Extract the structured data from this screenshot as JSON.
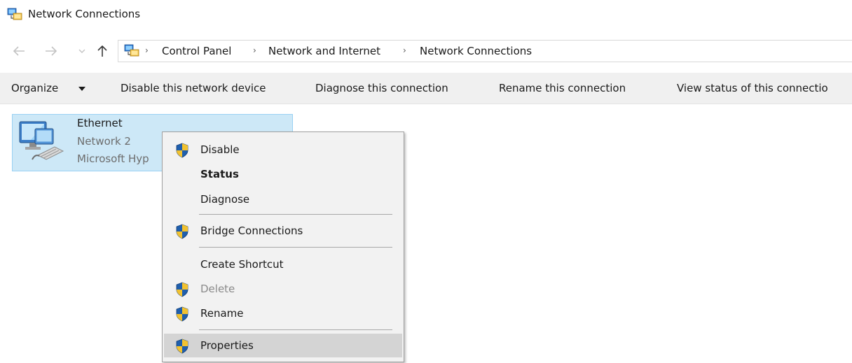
{
  "window": {
    "title": "Network Connections"
  },
  "address_bar": {
    "breadcrumbs": [
      "Control Panel",
      "Network and Internet",
      "Network Connections"
    ]
  },
  "command_bar": {
    "organize": "Organize",
    "disable": "Disable this network device",
    "diagnose": "Diagnose this connection",
    "rename": "Rename this connection",
    "view_status": "View status of this connectio"
  },
  "connection": {
    "name": "Ethernet",
    "network": "Network 2",
    "adapter": "Microsoft Hyp"
  },
  "context_menu": {
    "items": [
      {
        "label": "Disable",
        "icon": "uac-shield-icon"
      },
      {
        "label": "Status",
        "icon": "none"
      },
      {
        "label": "Diagnose",
        "icon": "none"
      },
      {
        "label": "Bridge Connections",
        "icon": "uac-shield-icon"
      },
      {
        "label": "Create Shortcut",
        "icon": "none"
      },
      {
        "label": "Delete",
        "icon": "uac-shield-icon"
      },
      {
        "label": "Rename",
        "icon": "uac-shield-icon"
      },
      {
        "label": "Properties",
        "icon": "uac-shield-icon"
      }
    ]
  },
  "colors": {
    "selection": "#cde8f7",
    "selection_border": "#99d1f3",
    "menu_background": "#f2f2f2",
    "menu_highlight": "#d4d4d4",
    "command_bar": "#f0f0f0"
  }
}
